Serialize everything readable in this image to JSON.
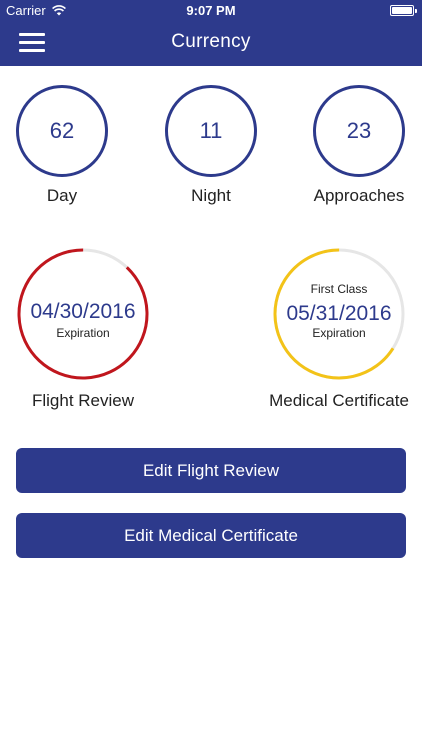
{
  "status_bar": {
    "carrier": "Carrier",
    "time": "9:07 PM"
  },
  "header": {
    "title": "Currency",
    "menu_icon": "hamburger-menu-icon"
  },
  "stats": [
    {
      "value": "62",
      "label": "Day"
    },
    {
      "value": "11",
      "label": "Night"
    },
    {
      "value": "23",
      "label": "Approaches"
    }
  ],
  "flight_review": {
    "date": "04/30/2016",
    "sub": "Expiration",
    "label": "Flight Review",
    "progress": 0.88,
    "color": "#c0161d"
  },
  "medical": {
    "class": "First Class",
    "date": "05/31/2016",
    "sub": "Expiration",
    "label": "Medical Certificate",
    "progress": 0.66,
    "color": "#f3c318"
  },
  "buttons": {
    "edit_flight_review": "Edit Flight Review",
    "edit_medical": "Edit Medical Certificate"
  },
  "colors": {
    "brand": "#2d3a8c",
    "track": "#e6e6e6"
  }
}
